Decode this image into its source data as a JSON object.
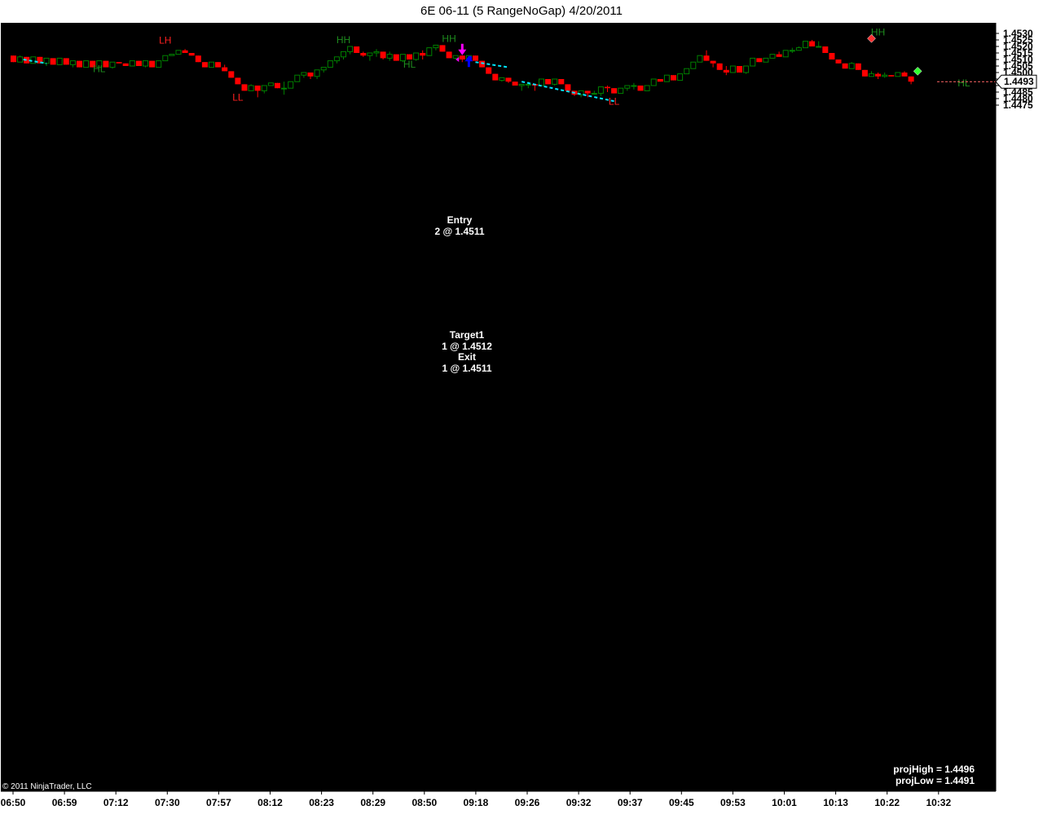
{
  "window": {
    "title": "6E 06-11 (5 RangeNoGap)  4/20/2011"
  },
  "colors": {
    "background": "#000000",
    "up": "#008000",
    "down": "#ff0000",
    "trend": "#00e5ff",
    "entry": "#ff00ff",
    "exit": "#0000ff"
  },
  "chart_data": {
    "type": "candlestick",
    "instrument": "6E 06-11",
    "bar_type": "5 RangeNoGap",
    "date": "4/20/2011",
    "ylim": [
      1.4473,
      1.4532
    ],
    "y_ticks": [
      "1.4530",
      "1.4525",
      "1.4520",
      "1.4515",
      "1.4510",
      "1.4505",
      "1.4500",
      "1.4495",
      "1.4490",
      "1.4485",
      "1.4480",
      "1.4475"
    ],
    "x_ticks": [
      "06:50",
      "06:59",
      "07:12",
      "07:30",
      "07:57",
      "08:12",
      "08:23",
      "08:29",
      "08:50",
      "09:18",
      "09:26",
      "09:32",
      "09:37",
      "09:45",
      "09:53",
      "10:01",
      "10:13",
      "10:22",
      "10:32"
    ],
    "last_price": "1.4493",
    "candles": [
      [
        1.4513,
        1.4513,
        1.4508,
        1.4508
      ],
      [
        1.4508,
        1.4513,
        1.4508,
        1.4512
      ],
      [
        1.4512,
        1.4512,
        1.4507,
        1.4507
      ],
      [
        1.4507,
        1.4512,
        1.4507,
        1.4512
      ],
      [
        1.4512,
        1.4512,
        1.4507,
        1.4507
      ],
      [
        1.4507,
        1.4511,
        1.4505,
        1.4511
      ],
      [
        1.4511,
        1.4511,
        1.4506,
        1.4506
      ],
      [
        1.4506,
        1.4511,
        1.4506,
        1.4511
      ],
      [
        1.4511,
        1.4511,
        1.4506,
        1.4506
      ],
      [
        1.4506,
        1.4509,
        1.4504,
        1.4509
      ],
      [
        1.4509,
        1.4509,
        1.4504,
        1.4504
      ],
      [
        1.4504,
        1.4509,
        1.4504,
        1.4509
      ],
      [
        1.4509,
        1.4509,
        1.4504,
        1.4504
      ],
      [
        1.4504,
        1.4509,
        1.4504,
        1.4509
      ],
      [
        1.4509,
        1.4509,
        1.4504,
        1.4504
      ],
      [
        1.4504,
        1.4508,
        1.4503,
        1.4508
      ],
      [
        1.4508,
        1.4508,
        1.4507,
        1.4507
      ],
      [
        1.4507,
        1.4507,
        1.4505,
        1.4505
      ],
      [
        1.4505,
        1.4509,
        1.4505,
        1.4509
      ],
      [
        1.4509,
        1.4509,
        1.4505,
        1.4505
      ],
      [
        1.4505,
        1.4509,
        1.4504,
        1.4509
      ],
      [
        1.4509,
        1.4509,
        1.4504,
        1.4504
      ],
      [
        1.4504,
        1.4509,
        1.4504,
        1.4509
      ],
      [
        1.4509,
        1.4513,
        1.4509,
        1.4513
      ],
      [
        1.4513,
        1.4514,
        1.4513,
        1.4514
      ],
      [
        1.4514,
        1.4517,
        1.4514,
        1.4517
      ],
      [
        1.4517,
        1.4518,
        1.4515,
        1.4515
      ],
      [
        1.4515,
        1.4515,
        1.4513,
        1.4513
      ],
      [
        1.4513,
        1.4513,
        1.4508,
        1.4508
      ],
      [
        1.4508,
        1.4508,
        1.4504,
        1.4504
      ],
      [
        1.4504,
        1.4508,
        1.4504,
        1.4508
      ],
      [
        1.4508,
        1.4508,
        1.4504,
        1.4504
      ],
      [
        1.4504,
        1.4506,
        1.4501,
        1.4501
      ],
      [
        1.4501,
        1.4501,
        1.4496,
        1.4496
      ],
      [
        1.4496,
        1.4496,
        1.4491,
        1.4491
      ],
      [
        1.4491,
        1.4491,
        1.4486,
        1.4486
      ],
      [
        1.4486,
        1.4491,
        1.4486,
        1.449
      ],
      [
        1.449,
        1.449,
        1.4481,
        1.4486
      ],
      [
        1.4486,
        1.449,
        1.4484,
        1.449
      ],
      [
        1.449,
        1.4492,
        1.449,
        1.4492
      ],
      [
        1.4492,
        1.4492,
        1.4488,
        1.4488
      ],
      [
        1.4488,
        1.4493,
        1.4483,
        1.4488
      ],
      [
        1.4488,
        1.4493,
        1.4488,
        1.4493
      ],
      [
        1.4493,
        1.4498,
        1.4493,
        1.4498
      ],
      [
        1.4498,
        1.45,
        1.4496,
        1.45
      ],
      [
        1.45,
        1.45,
        1.4495,
        1.4497
      ],
      [
        1.4497,
        1.4502,
        1.4495,
        1.4502
      ],
      [
        1.4502,
        1.4504,
        1.45,
        1.4504
      ],
      [
        1.4504,
        1.4509,
        1.4504,
        1.4509
      ],
      [
        1.4509,
        1.4512,
        1.4507,
        1.4512
      ],
      [
        1.4512,
        1.4516,
        1.451,
        1.4516
      ],
      [
        1.4516,
        1.452,
        1.4514,
        1.452
      ],
      [
        1.452,
        1.452,
        1.4515,
        1.4515
      ],
      [
        1.4515,
        1.4516,
        1.4512,
        1.4513
      ],
      [
        1.4513,
        1.4515,
        1.4509,
        1.4515
      ],
      [
        1.4515,
        1.4518,
        1.4512,
        1.4516
      ],
      [
        1.4516,
        1.4516,
        1.451,
        1.4511
      ],
      [
        1.4511,
        1.4516,
        1.4509,
        1.4514
      ],
      [
        1.4514,
        1.4514,
        1.4509,
        1.4509
      ],
      [
        1.4509,
        1.4514,
        1.4508,
        1.4514
      ],
      [
        1.4514,
        1.4514,
        1.451,
        1.451
      ],
      [
        1.451,
        1.4515,
        1.4509,
        1.4515
      ],
      [
        1.4515,
        1.4517,
        1.451,
        1.4513
      ],
      [
        1.4513,
        1.4519,
        1.4513,
        1.4519
      ],
      [
        1.4519,
        1.4521,
        1.4517,
        1.4521
      ],
      [
        1.4521,
        1.4521,
        1.4516,
        1.4516
      ],
      [
        1.4516,
        1.4516,
        1.4511,
        1.4511
      ],
      [
        1.4511,
        1.4513,
        1.451,
        1.4513
      ],
      [
        1.4513,
        1.4513,
        1.4508,
        1.451
      ],
      [
        1.451,
        1.4513,
        1.4508,
        1.4513
      ],
      [
        1.4513,
        1.4513,
        1.4509,
        1.4509
      ],
      [
        1.4509,
        1.4509,
        1.4504,
        1.4504
      ],
      [
        1.4504,
        1.4504,
        1.4499,
        1.4499
      ],
      [
        1.4499,
        1.4499,
        1.4494,
        1.4494
      ],
      [
        1.4494,
        1.4496,
        1.4493,
        1.4496
      ],
      [
        1.4496,
        1.4496,
        1.4492,
        1.4493
      ],
      [
        1.4493,
        1.4493,
        1.449,
        1.449
      ],
      [
        1.449,
        1.4491,
        1.4486,
        1.4491
      ],
      [
        1.4491,
        1.4493,
        1.4488,
        1.4491
      ],
      [
        1.4491,
        1.4491,
        1.4486,
        1.449
      ],
      [
        1.449,
        1.4495,
        1.449,
        1.4495
      ],
      [
        1.4495,
        1.4495,
        1.4491,
        1.4491
      ],
      [
        1.4491,
        1.4495,
        1.449,
        1.4495
      ],
      [
        1.4495,
        1.4495,
        1.4491,
        1.4491
      ],
      [
        1.4491,
        1.4491,
        1.4486,
        1.4486
      ],
      [
        1.4486,
        1.4486,
        1.4482,
        1.4483
      ],
      [
        1.4483,
        1.4486,
        1.4481,
        1.4486
      ],
      [
        1.4486,
        1.4486,
        1.4481,
        1.4484
      ],
      [
        1.4484,
        1.4486,
        1.4483,
        1.4484
      ],
      [
        1.4484,
        1.4489,
        1.4482,
        1.4489
      ],
      [
        1.4489,
        1.449,
        1.4485,
        1.4488
      ],
      [
        1.4488,
        1.4488,
        1.4484,
        1.4484
      ],
      [
        1.4484,
        1.4488,
        1.4484,
        1.4488
      ],
      [
        1.4488,
        1.449,
        1.4486,
        1.449
      ],
      [
        1.449,
        1.4492,
        1.4487,
        1.449
      ],
      [
        1.449,
        1.449,
        1.4486,
        1.4486
      ],
      [
        1.4486,
        1.449,
        1.4486,
        1.449
      ],
      [
        1.449,
        1.4495,
        1.449,
        1.4495
      ],
      [
        1.4495,
        1.4495,
        1.4493,
        1.4493
      ],
      [
        1.4493,
        1.4498,
        1.4493,
        1.4498
      ],
      [
        1.4498,
        1.4498,
        1.4494,
        1.4494
      ],
      [
        1.4494,
        1.4499,
        1.4494,
        1.4499
      ],
      [
        1.4499,
        1.4503,
        1.4499,
        1.4503
      ],
      [
        1.4503,
        1.4508,
        1.4503,
        1.4508
      ],
      [
        1.4508,
        1.4513,
        1.4508,
        1.4513
      ],
      [
        1.4513,
        1.4517,
        1.4509,
        1.4509
      ],
      [
        1.4509,
        1.4509,
        1.4504,
        1.4507
      ],
      [
        1.4507,
        1.4507,
        1.4502,
        1.4502
      ],
      [
        1.4502,
        1.4505,
        1.4498,
        1.45
      ],
      [
        1.45,
        1.4505,
        1.45,
        1.4505
      ],
      [
        1.4505,
        1.4505,
        1.45,
        1.45
      ],
      [
        1.45,
        1.4505,
        1.4499,
        1.4505
      ],
      [
        1.4505,
        1.4511,
        1.4505,
        1.4511
      ],
      [
        1.4511,
        1.4511,
        1.4508,
        1.4508
      ],
      [
        1.4508,
        1.4511,
        1.4508,
        1.4511
      ],
      [
        1.4511,
        1.4514,
        1.4511,
        1.4514
      ],
      [
        1.4514,
        1.4516,
        1.4512,
        1.4512
      ],
      [
        1.4512,
        1.4517,
        1.4512,
        1.4517
      ],
      [
        1.4517,
        1.4519,
        1.4515,
        1.4517
      ],
      [
        1.4517,
        1.452,
        1.4517,
        1.4519
      ],
      [
        1.4519,
        1.4524,
        1.4519,
        1.4524
      ],
      [
        1.4524,
        1.4525,
        1.452,
        1.452
      ],
      [
        1.452,
        1.4524,
        1.452,
        1.452
      ],
      [
        1.452,
        1.452,
        1.4515,
        1.4515
      ],
      [
        1.4515,
        1.4515,
        1.451,
        1.451
      ],
      [
        1.451,
        1.451,
        1.4507,
        1.4507
      ],
      [
        1.4507,
        1.4507,
        1.4503,
        1.4503
      ],
      [
        1.4503,
        1.4508,
        1.4503,
        1.4507
      ],
      [
        1.4507,
        1.4507,
        1.4502,
        1.4502
      ],
      [
        1.4502,
        1.4502,
        1.4497,
        1.4497
      ],
      [
        1.4497,
        1.4501,
        1.4497,
        1.4499
      ],
      [
        1.4499,
        1.45,
        1.4495,
        1.4497
      ],
      [
        1.4497,
        1.45,
        1.4496,
        1.4498
      ],
      [
        1.4498,
        1.4498,
        1.4497,
        1.4497
      ],
      [
        1.4497,
        1.45,
        1.4497,
        1.45
      ],
      [
        1.45,
        1.4501,
        1.4497,
        1.4497
      ],
      [
        1.4497,
        1.4497,
        1.4491,
        1.4493
      ]
    ],
    "swing_labels": [
      {
        "text": "LH",
        "bar": 23,
        "price": 1.45221,
        "color": "#ff2020"
      },
      {
        "text": "HL",
        "bar": 13,
        "price": 1.45003,
        "color": "#1e8c1e"
      },
      {
        "text": "LL",
        "bar": 34,
        "price": 1.44783,
        "color": "#ff2020"
      },
      {
        "text": "HH",
        "bar": 50,
        "price": 1.45226,
        "color": "#1e8c1e"
      },
      {
        "text": "HH",
        "bar": 66,
        "price": 1.45233,
        "color": "#1e8c1e"
      },
      {
        "text": "HL",
        "bar": 60,
        "price": 1.45038,
        "color": "#1e8c1e"
      },
      {
        "text": "LL",
        "bar": 91,
        "price": 1.44753,
        "color": "#ff2020"
      },
      {
        "text": "HH",
        "bar": 131,
        "price": 1.45283,
        "color": "#1e8c1e"
      },
      {
        "text": "HL",
        "bar": 144,
        "price": 1.44893,
        "color": "#1e8c1e"
      }
    ],
    "trend_lines": [
      [
        [
          1.5,
          1.451
        ],
        [
          5,
          1.4507
        ]
      ],
      [
        [
          70,
          1.4508
        ],
        [
          75,
          1.4504
        ]
      ],
      [
        [
          77,
          1.4493
        ],
        [
          91,
          1.4478
        ]
      ]
    ],
    "markers": [
      {
        "type": "diamond",
        "bar": 130,
        "price": 1.45261,
        "color": "#ff3030"
      },
      {
        "type": "diamond",
        "bar": 137,
        "price": 1.4501,
        "color": "#30ff30"
      }
    ],
    "trade": {
      "entry_title": "Entry",
      "entry_text": "2 @ 1.4511",
      "target_title": "Target1",
      "target_text": "1 @ 1.4512",
      "exit_title": "Exit",
      "exit_text": "1 @ 1.4511"
    },
    "info": {
      "proj_high": "projHigh = 1.4496",
      "proj_low": "projLow = 1.4491",
      "copyright": "© 2011 NinjaTrader, LLC"
    }
  }
}
